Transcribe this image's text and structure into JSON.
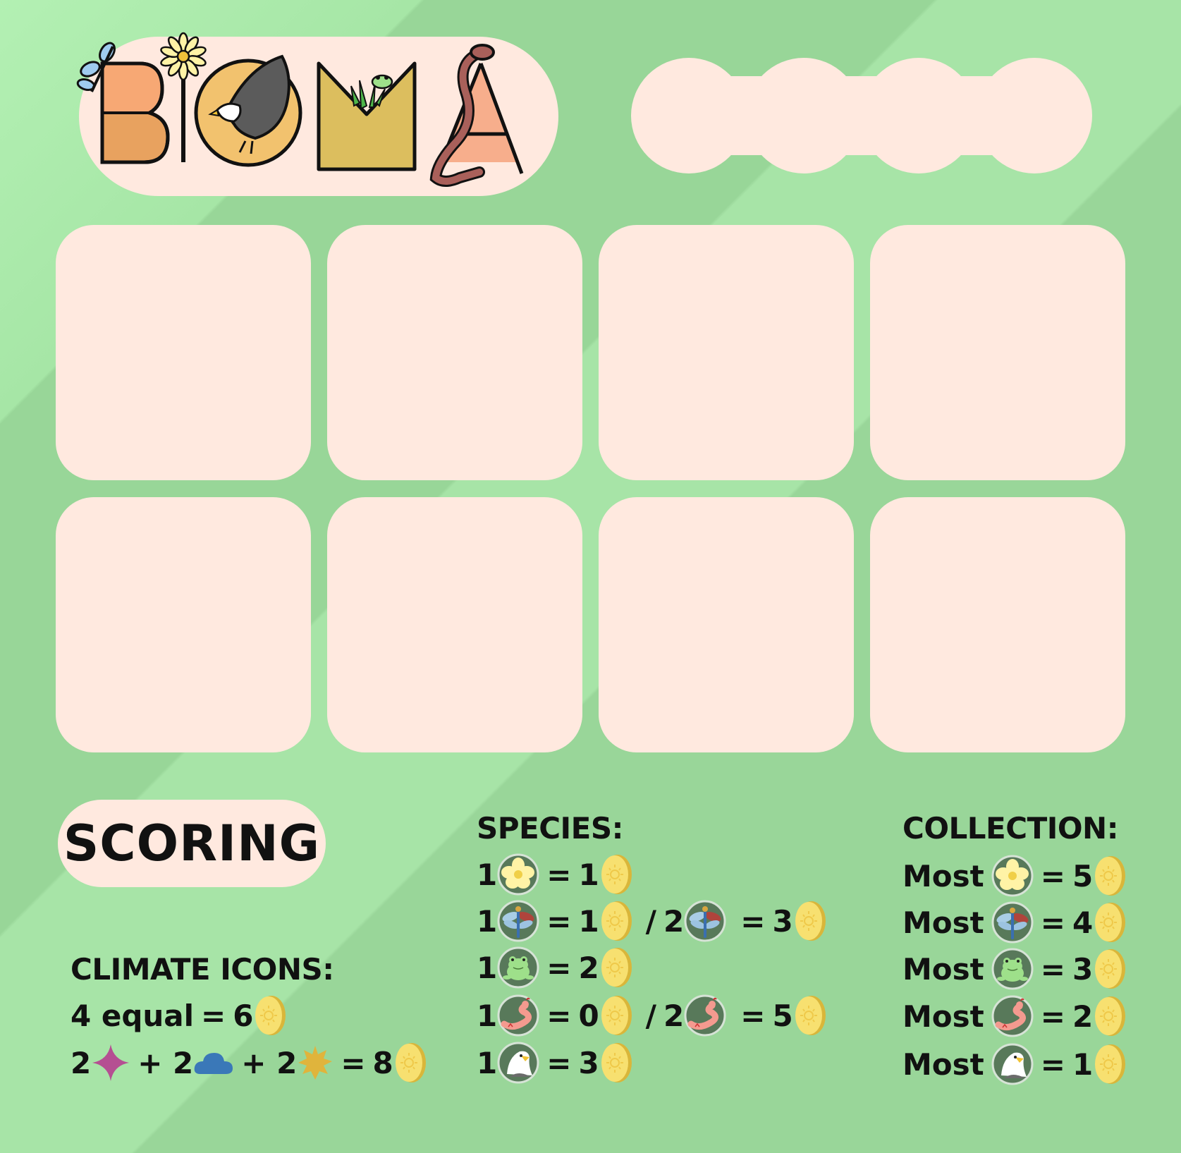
{
  "game": {
    "title_letters": [
      "B",
      "I",
      "O",
      "M",
      "A"
    ]
  },
  "board": {
    "card_slots": 8
  },
  "scoring": {
    "title": "SCORING",
    "climate": {
      "heading": "CLIMATE ICONS:",
      "rule1": {
        "left": "4 equal",
        "eq": "=",
        "points": "6"
      },
      "rule2": {
        "c1": "2",
        "plus1": "+ 2",
        "plus2": "+ 2",
        "eq": "=",
        "points": "8"
      }
    },
    "species": {
      "heading": "SPECIES:",
      "rows": [
        {
          "n1": "1",
          "icon": "flower-icon",
          "eq1": "=",
          "p1": "1"
        },
        {
          "n1": "1",
          "icon": "dragonfly-icon",
          "eq1": "=",
          "p1": "1",
          "sep": "/",
          "n2": "2",
          "eq2": "=",
          "p2": "3"
        },
        {
          "n1": "1",
          "icon": "frog-icon",
          "eq1": "=",
          "p1": "2"
        },
        {
          "n1": "1",
          "icon": "snake-icon",
          "eq1": "=",
          "p1": "0",
          "sep": "/",
          "n2": "2",
          "eq2": "=",
          "p2": "5"
        },
        {
          "n1": "1",
          "icon": "eagle-icon",
          "eq1": "=",
          "p1": "3"
        }
      ]
    },
    "collection": {
      "heading": "COLLECTION:",
      "rows": [
        {
          "label": "Most",
          "icon": "flower-icon",
          "eq": "=",
          "points": "5"
        },
        {
          "label": "Most",
          "icon": "dragonfly-icon",
          "eq": "=",
          "points": "4"
        },
        {
          "label": "Most",
          "icon": "frog-icon",
          "eq": "=",
          "points": "3"
        },
        {
          "label": "Most",
          "icon": "snake-icon",
          "eq": "=",
          "points": "2"
        },
        {
          "label": "Most",
          "icon": "eagle-icon",
          "eq": "=",
          "points": "1"
        }
      ]
    }
  },
  "colors": {
    "background": "#a6e3a6",
    "panel": "#ffe9df",
    "coin": "#f5dc66",
    "sparkle": "#b54f92",
    "cloud": "#3a78b8",
    "sun": "#e0b43c"
  }
}
